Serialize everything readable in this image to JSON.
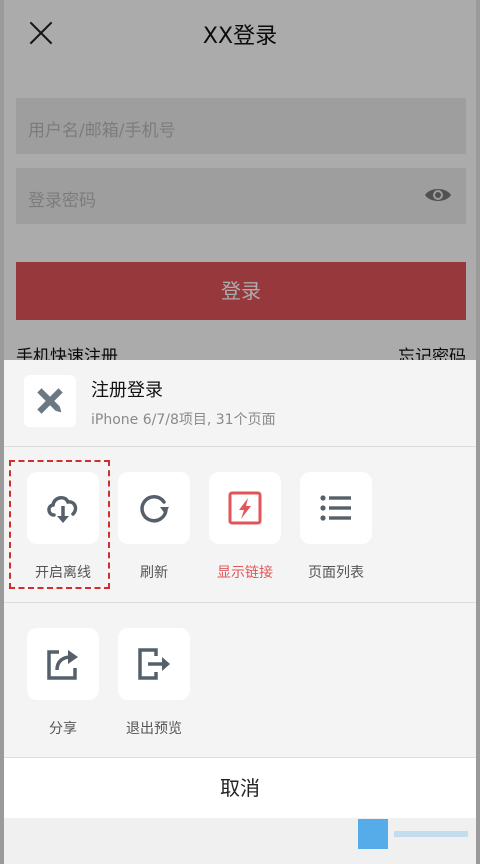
{
  "login": {
    "title": "XX登录",
    "username_placeholder": "用户名/邮箱/手机号",
    "password_placeholder": "登录密码",
    "login_button": "登录",
    "register_link": "手机快速注册",
    "forgot_link": "忘记密码"
  },
  "sheet": {
    "app_name": "注册登录",
    "app_meta": "iPhone 6/7/8项目, 31个页面",
    "row1": [
      {
        "label": "开启离线",
        "icon": "cloud-download-icon"
      },
      {
        "label": "刷新",
        "icon": "refresh-icon"
      },
      {
        "label": "显示链接",
        "icon": "link-flash-icon",
        "color": "#e2565a"
      },
      {
        "label": "页面列表",
        "icon": "list-icon"
      }
    ],
    "row2": [
      {
        "label": "分享",
        "icon": "share-icon"
      },
      {
        "label": "退出预览",
        "icon": "exit-icon"
      }
    ],
    "cancel": "取消"
  },
  "colors": {
    "accent_red": "#e2565a",
    "icon_gray": "#56606a",
    "highlight_dash": "#d0302c"
  }
}
